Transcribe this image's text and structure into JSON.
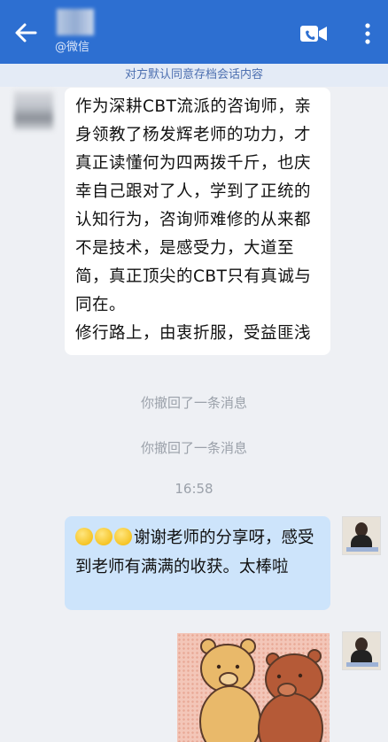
{
  "header": {
    "back_icon": "arrow-left-icon",
    "subtitle": "@微信",
    "video_icon": "video-call-icon",
    "more_icon": "more-vertical-icon",
    "color": "#2d6fd1"
  },
  "notice": "对方默认同意存档会话内容",
  "messages": {
    "incoming": {
      "lines": [
        "作为深耕CBT流派的咨询师，亲身领教了杨发辉老师的功力，才真正读懂何为四两拨千斤，也庆幸自己跟对了人，学到了正统的认知行为，咨询师难修的从来都不是技术，是感受力，大道至简，真正顶尖的CBT只有真诚与同在。",
        "修行路上，由衷折服，受益匪浅"
      ]
    },
    "system": [
      "你撤回了一条消息",
      "你撤回了一条消息"
    ],
    "time": "16:58",
    "outgoing": {
      "emoji_count": 3,
      "text": "谢谢老师的分享呀，感受到老师有满满的收获。太棒啦"
    },
    "sticker": "bear-sticker"
  }
}
